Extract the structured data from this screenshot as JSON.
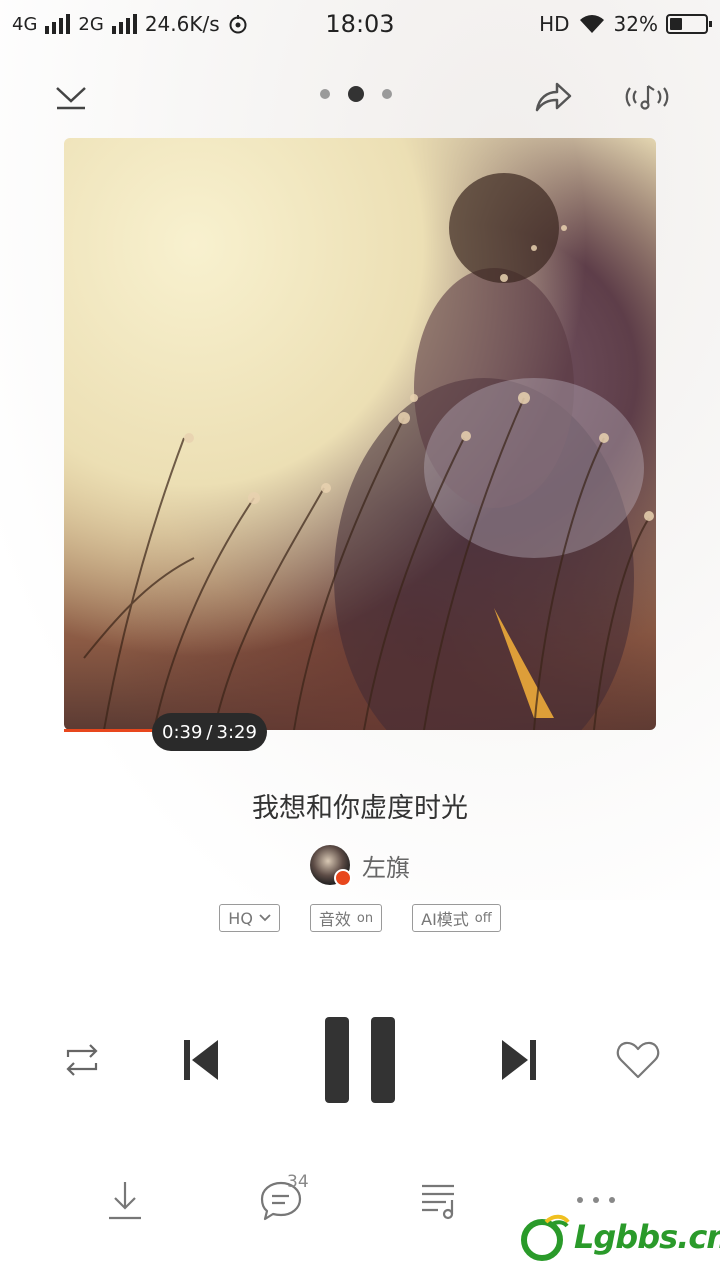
{
  "status_bar": {
    "net1": "4G",
    "net2": "2G",
    "speed": "24.6K/s",
    "time": "18:03",
    "hd": "HD",
    "battery": "32%"
  },
  "header": {
    "page_count": 3,
    "active_page": 2
  },
  "player": {
    "elapsed": "0:39",
    "separator": "/",
    "duration": "3:29",
    "progress_fraction": 0.186
  },
  "song": {
    "title": "我想和你虚度时光",
    "artist": "左旗"
  },
  "tags": {
    "quality": "HQ",
    "effect_label": "音效",
    "effect_state": "on",
    "ai_label": "AI模式",
    "ai_state": "off"
  },
  "bottom": {
    "comment_count": "34"
  },
  "watermark": {
    "text": "Lgbbs.cn"
  },
  "colors": {
    "accent": "#e8471d",
    "icon": "#555555",
    "icon_light": "#9a9a9a"
  }
}
